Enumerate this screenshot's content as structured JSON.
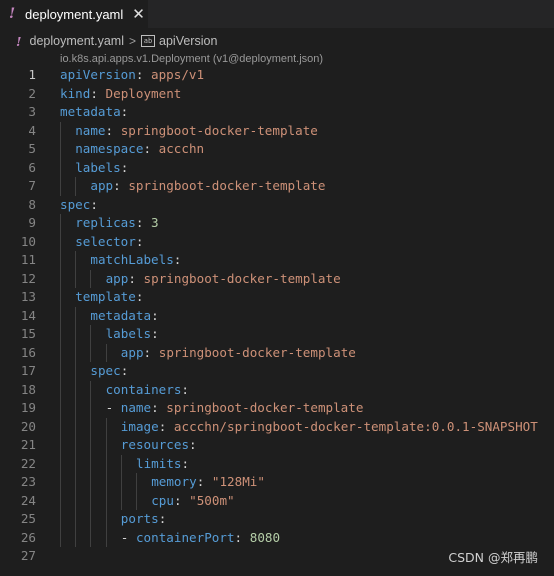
{
  "tab": {
    "label": "deployment.yaml",
    "icon": "!",
    "close": "✕"
  },
  "breadcrumb": {
    "file": "deployment.yaml",
    "separator": ">",
    "symbol": "apiVersion"
  },
  "schema_hint": "io.k8s.api.apps.v1.Deployment (v1@deployment.json)",
  "lines": [
    {
      "n": "1",
      "indent": 0,
      "key": "apiVersion",
      "value": "apps/v1",
      "vtype": "s"
    },
    {
      "n": "2",
      "indent": 0,
      "key": "kind",
      "value": "Deployment",
      "vtype": "s"
    },
    {
      "n": "3",
      "indent": 0,
      "key": "metadata",
      "value": "",
      "vtype": ""
    },
    {
      "n": "4",
      "indent": 1,
      "key": "name",
      "value": "springboot-docker-template",
      "vtype": "s"
    },
    {
      "n": "5",
      "indent": 1,
      "key": "namespace",
      "value": "accchn",
      "vtype": "s"
    },
    {
      "n": "6",
      "indent": 1,
      "key": "labels",
      "value": "",
      "vtype": ""
    },
    {
      "n": "7",
      "indent": 2,
      "key": "app",
      "value": "springboot-docker-template",
      "vtype": "s"
    },
    {
      "n": "8",
      "indent": 0,
      "key": "spec",
      "value": "",
      "vtype": ""
    },
    {
      "n": "9",
      "indent": 1,
      "key": "replicas",
      "value": "3",
      "vtype": "n"
    },
    {
      "n": "10",
      "indent": 1,
      "key": "selector",
      "value": "",
      "vtype": ""
    },
    {
      "n": "11",
      "indent": 2,
      "key": "matchLabels",
      "value": "",
      "vtype": ""
    },
    {
      "n": "12",
      "indent": 3,
      "key": "app",
      "value": "springboot-docker-template",
      "vtype": "s"
    },
    {
      "n": "13",
      "indent": 1,
      "key": "template",
      "value": "",
      "vtype": ""
    },
    {
      "n": "14",
      "indent": 2,
      "key": "metadata",
      "value": "",
      "vtype": ""
    },
    {
      "n": "15",
      "indent": 3,
      "key": "labels",
      "value": "",
      "vtype": ""
    },
    {
      "n": "16",
      "indent": 4,
      "key": "app",
      "value": "springboot-docker-template",
      "vtype": "s"
    },
    {
      "n": "17",
      "indent": 2,
      "key": "spec",
      "value": "",
      "vtype": ""
    },
    {
      "n": "18",
      "indent": 3,
      "key": "containers",
      "value": "",
      "vtype": ""
    },
    {
      "n": "19",
      "indent": 3,
      "dash": true,
      "key": "name",
      "value": "springboot-docker-template",
      "vtype": "s"
    },
    {
      "n": "20",
      "indent": 4,
      "key": "image",
      "value": "accchn/springboot-docker-template:0.0.1-SNAPSHOT",
      "vtype": "s"
    },
    {
      "n": "21",
      "indent": 4,
      "key": "resources",
      "value": "",
      "vtype": ""
    },
    {
      "n": "22",
      "indent": 5,
      "key": "limits",
      "value": "",
      "vtype": ""
    },
    {
      "n": "23",
      "indent": 6,
      "key": "memory",
      "value": "\"128Mi\"",
      "vtype": "s"
    },
    {
      "n": "24",
      "indent": 6,
      "key": "cpu",
      "value": "\"500m\"",
      "vtype": "s"
    },
    {
      "n": "25",
      "indent": 4,
      "key": "ports",
      "value": "",
      "vtype": ""
    },
    {
      "n": "26",
      "indent": 4,
      "dash": true,
      "key": "containerPort",
      "value": "8080",
      "vtype": "n"
    },
    {
      "n": "27",
      "indent": 0,
      "key": "",
      "value": "",
      "vtype": ""
    }
  ],
  "active_line": "1",
  "watermark": "CSDN @郑再鹏",
  "colors": {
    "key": "#569cd6",
    "string": "#ce9178",
    "number": "#b5cea8",
    "yaml_icon": "#c586c0"
  }
}
